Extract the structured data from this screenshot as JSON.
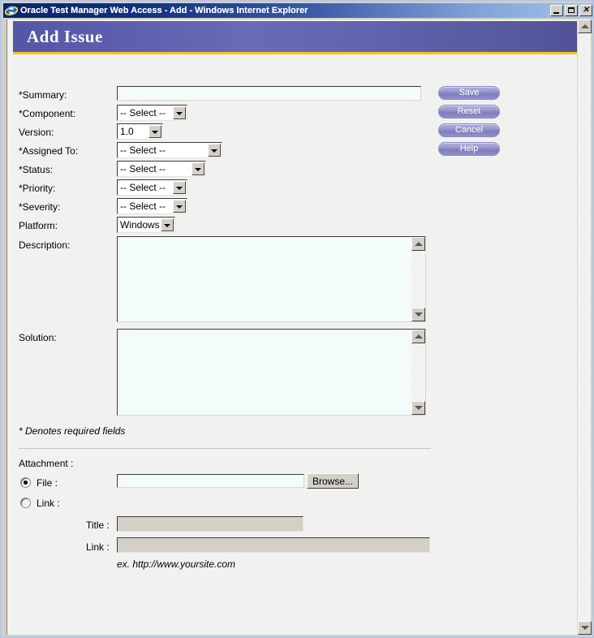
{
  "window": {
    "title": "Oracle Test Manager Web Access - Add - Windows Internet Explorer",
    "app_icon": "ie-logo-icon",
    "minimize_label": "Minimize",
    "maximize_label": "Maximize",
    "close_label": "Close",
    "close_glyph": "✕"
  },
  "banner": {
    "title": "Add Issue",
    "bg_color": "#5b5bb0",
    "rule_color": "#f5c518"
  },
  "form": {
    "fields": [
      {
        "label": "*Summary:",
        "name": "summary",
        "type": "text",
        "value": "",
        "required": true
      },
      {
        "label": "*Component:",
        "name": "component",
        "type": "select",
        "value": "-- Select --",
        "required": true
      },
      {
        "label": "Version:",
        "name": "version",
        "type": "select",
        "value": "1.0",
        "required": false
      },
      {
        "label": "*Assigned To:",
        "name": "assigned-to",
        "type": "select",
        "value": "-- Select --",
        "required": true
      },
      {
        "label": "*Status:",
        "name": "status",
        "type": "select",
        "value": "-- Select --",
        "required": true
      },
      {
        "label": "*Priority:",
        "name": "priority",
        "type": "select",
        "value": "-- Select --",
        "required": true
      },
      {
        "label": "*Severity:",
        "name": "severity",
        "type": "select",
        "value": "-- Select --",
        "required": true
      },
      {
        "label": "Platform:",
        "name": "platform",
        "type": "select",
        "value": "Windows",
        "required": false
      },
      {
        "label": "Description:",
        "name": "description",
        "type": "textarea",
        "value": "",
        "required": false
      },
      {
        "label": "Solution:",
        "name": "solution",
        "type": "textarea",
        "value": "",
        "required": false
      }
    ],
    "required_note": "* Denotes required fields"
  },
  "actions": {
    "save": "Save",
    "reset": "Reset",
    "cancel": "Cancel",
    "help": "Help",
    "accent_color": "#8787c6"
  },
  "attachment": {
    "heading": "Attachment :",
    "file_label": "File :",
    "file_selected": true,
    "file_value": "",
    "browse_label": "Browse...",
    "link_label": "Link :",
    "link_selected": false,
    "title_label": "Title :",
    "title_value": "",
    "link_field_label": "Link :",
    "link_field_value": "",
    "example": "ex. http://www.yoursite.com"
  },
  "scrollbars": {
    "up_arrow": "scroll-up-icon",
    "down_arrow": "scroll-down-icon"
  }
}
